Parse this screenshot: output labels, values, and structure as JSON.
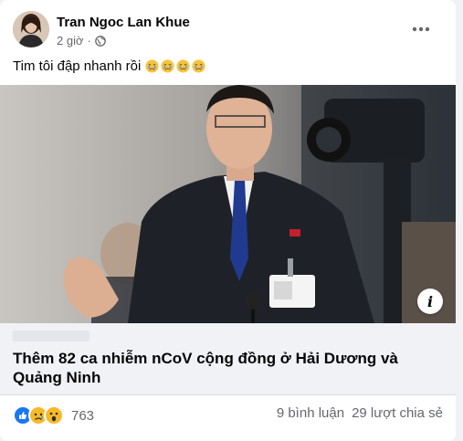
{
  "post": {
    "author": "Tran Ngoc Lan Khue",
    "time": "2 giờ",
    "privacy_icon": "globe-icon",
    "more_icon": "more-dots-icon",
    "text": "Tim tôi đập nhanh rồi",
    "text_emojis": [
      "crying-face",
      "crying-face",
      "crying-face",
      "crying-face"
    ]
  },
  "link_preview": {
    "headline": "Thêm 82 ca nhiễm nCoV cộng đồng ở Hải Dương và Quảng Ninh",
    "info_icon": "info-icon"
  },
  "footer": {
    "reactions": [
      "like",
      "sad",
      "wow"
    ],
    "reaction_count": "763",
    "comments": "9 bình luận",
    "shares": "29 lượt chia sẻ"
  },
  "colors": {
    "like": "#1877f2",
    "reaction_yellow": "#f7b928",
    "secondary_text": "#65676b",
    "link_box_bg": "#f0f2f5"
  }
}
